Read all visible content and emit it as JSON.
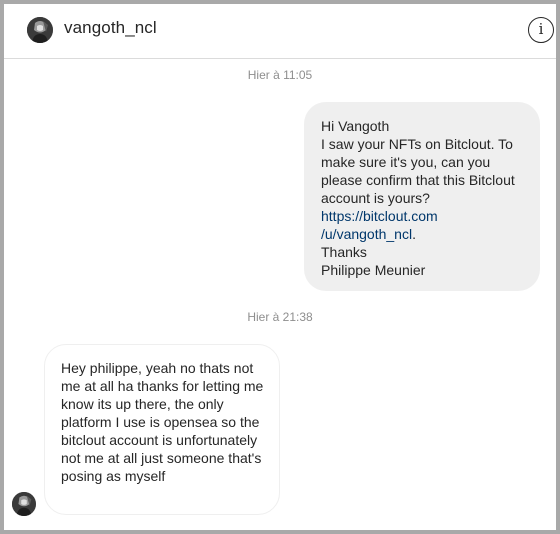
{
  "conversation": {
    "username": "vangoth_ncl",
    "avatar_icon": "profile-avatar-icon",
    "info_icon": "info-icon",
    "info_glyph": "i"
  },
  "messages": [
    {
      "timestamp": "Hier à 11:05",
      "direction": "outgoing",
      "lines_before_link": "Hi Vangoth\nI saw your NFTs on Bitclout. To make sure it's you, can you please confirm that this Bitclout account is yours?",
      "link_part1": "https://bitclout.com",
      "link_part2": "/u/vangoth_ncl",
      "after_link": ".",
      "lines_after": "Thanks\nPhilippe Meunier"
    },
    {
      "timestamp": "Hier à 21:38",
      "direction": "incoming",
      "text": "Hey philippe, yeah no thats not me at all ha thanks for letting me know its up there, the only platform I use is opensea so the bitclout account is unfortunately not me at all just someone that's posing as myself"
    }
  ],
  "colors": {
    "outgoing_bubble": "#efefef",
    "incoming_border": "#efefef",
    "link": "#00376b",
    "timestamp": "#8e8e8e"
  }
}
